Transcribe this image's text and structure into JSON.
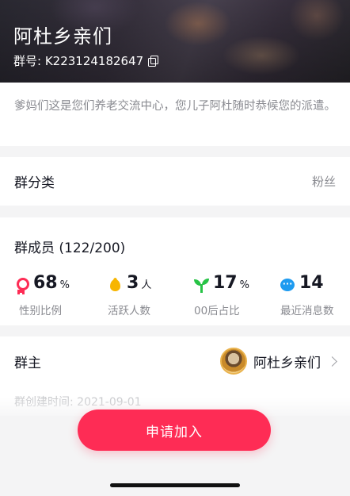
{
  "header": {
    "group_name": "阿杜乡亲们",
    "group_id": "群号: K223124182647"
  },
  "description": "爹妈们这是您们养老交流中心，您儿子阿杜随时恭候您的派遣。",
  "category": {
    "label": "群分类",
    "value": "粉丝"
  },
  "members": {
    "title": "群成员 (122/200)",
    "stats": [
      {
        "icon": "gender-icon",
        "value": "68",
        "unit": "%",
        "label": "性别比例",
        "color": "#fe2c55"
      },
      {
        "icon": "fire-icon",
        "value": "3",
        "unit": "人",
        "label": "活跃人数",
        "color": "#f7b500"
      },
      {
        "icon": "sprout-icon",
        "value": "17",
        "unit": "%",
        "label": "00后占比",
        "color": "#27c346"
      },
      {
        "icon": "chat-icon",
        "value": "14",
        "unit": "",
        "label": "最近消息数",
        "color": "#1e9bf0"
      }
    ]
  },
  "owner": {
    "label": "群主",
    "name": "阿杜乡亲们"
  },
  "created": "群创建时间: 2021-09-01",
  "actions": {
    "join_label": "申请加入"
  },
  "colors": {
    "accent": "#fe2c55"
  }
}
